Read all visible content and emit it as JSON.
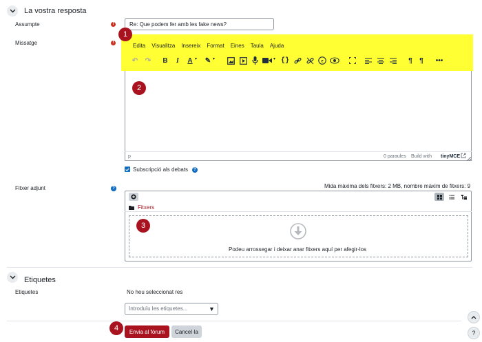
{
  "section_reply": {
    "title": "La vostra resposta"
  },
  "subject": {
    "label": "Assumpte",
    "value": "Re: Que podem fer amb les fake news?"
  },
  "message": {
    "label": "Missatge"
  },
  "editor": {
    "menus": [
      "Edita",
      "Visualitza",
      "Insereix",
      "Format",
      "Eines",
      "Taula",
      "Ajuda"
    ],
    "status_path": "p",
    "word_count": "0 paraules",
    "build_with": "Build with",
    "brand": "tinyMCE"
  },
  "subscription": {
    "label": "Subscripció als debats",
    "checked": true
  },
  "attachment": {
    "label": "Fitxer adjunt",
    "max_info": "Mida màxima dels fitxers: 2 MB, nombre màxim de fitxers: 9",
    "folder_label": "Fitxers",
    "drop_text": "Podeu arrossegar i deixar anar fitxers aquí per afegir-los"
  },
  "section_tags": {
    "title": "Etiquetes"
  },
  "tags": {
    "label": "Etiquetes",
    "none_selected": "No heu seleccionat res",
    "placeholder": "Introduïu les etiquetes..."
  },
  "buttons": {
    "submit": "Envia al fòrum",
    "cancel": "Cancel·la"
  },
  "badges": [
    "1",
    "2",
    "3",
    "4"
  ],
  "colors": {
    "accent": "#a8131f",
    "highlight": "#ffff33",
    "help": "#0f6cbf",
    "required": "#ca3120"
  },
  "icons": {
    "toolbar": [
      "undo-icon",
      "redo-icon",
      "bold-icon",
      "italic-icon",
      "text-color-icon",
      "highlight-color-icon",
      "image-icon",
      "media-icon",
      "record-audio-icon",
      "record-video-icon",
      "code-icon",
      "link-icon",
      "unlink-icon",
      "equation-icon",
      "accessibility-checker-icon",
      "fullscreen-icon",
      "align-left-icon",
      "align-center-icon",
      "align-right-icon",
      "ltr-icon",
      "rtl-icon",
      "more-icon"
    ]
  }
}
